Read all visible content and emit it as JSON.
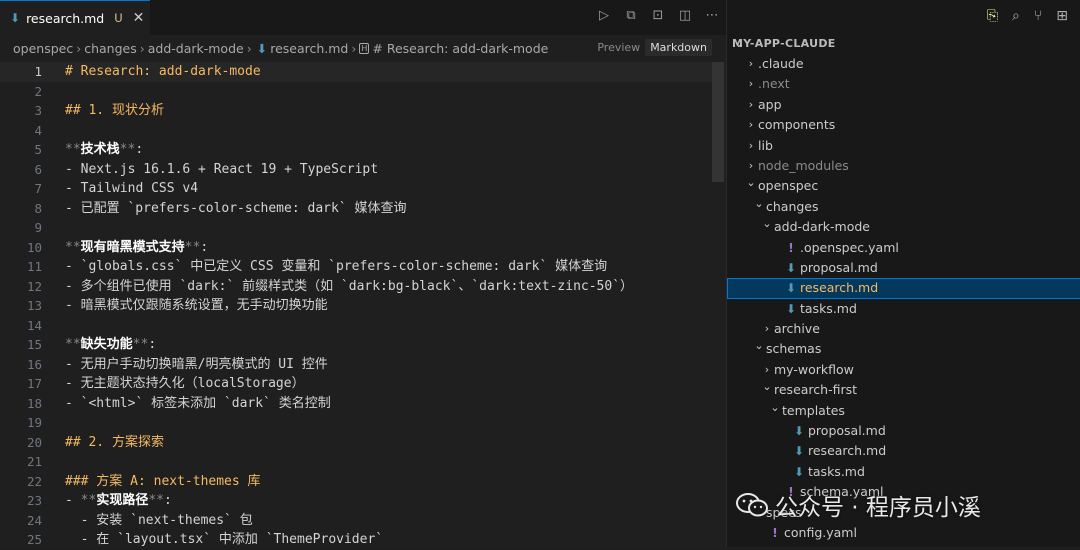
{
  "tab": {
    "title": "research.md",
    "modified": "U",
    "close": "✕"
  },
  "breadcrumb": {
    "parts": [
      "openspec",
      "changes",
      "add-dark-mode",
      "research.md",
      "# Research: add-dark-mode"
    ],
    "preview_label": "Preview",
    "markdown_label": "Markdown"
  },
  "editor": {
    "lines": [
      {
        "n": "1",
        "text": "# Research: add-dark-mode",
        "cls": "h1",
        "current": true
      },
      {
        "n": "2",
        "text": ""
      },
      {
        "n": "3",
        "text": "## 1. 现状分析",
        "cls": "h2"
      },
      {
        "n": "4",
        "text": ""
      },
      {
        "n": "5",
        "bold": "技术栈",
        "tail": ":"
      },
      {
        "n": "6",
        "text": "- Next.js 16.1.6 + React 19 + TypeScript"
      },
      {
        "n": "7",
        "text": "- Tailwind CSS v4"
      },
      {
        "n": "8",
        "text": "- 已配置 `prefers-color-scheme: dark` 媒体查询"
      },
      {
        "n": "9",
        "text": ""
      },
      {
        "n": "10",
        "bold": "现有暗黑模式支持",
        "tail": ":"
      },
      {
        "n": "11",
        "text": "- `globals.css` 中已定义 CSS 变量和 `prefers-color-scheme: dark` 媒体查询"
      },
      {
        "n": "12",
        "text": "- 多个组件已使用 `dark:` 前缀样式类（如 `dark:bg-black`、`dark:text-zinc-50`）"
      },
      {
        "n": "13",
        "text": "- 暗黑模式仅跟随系统设置，无手动切换功能"
      },
      {
        "n": "14",
        "text": ""
      },
      {
        "n": "15",
        "bold": "缺失功能",
        "tail": ":"
      },
      {
        "n": "16",
        "text": "- 无用户手动切换暗黑/明亮模式的 UI 控件"
      },
      {
        "n": "17",
        "text": "- 无主题状态持久化（localStorage）"
      },
      {
        "n": "18",
        "text": "- `<html>` 标签未添加 `dark` 类名控制"
      },
      {
        "n": "19",
        "text": ""
      },
      {
        "n": "20",
        "text": "## 2. 方案探索",
        "cls": "h2"
      },
      {
        "n": "21",
        "text": ""
      },
      {
        "n": "22",
        "text": "### 方案 A: next-themes 库",
        "cls": "h3"
      },
      {
        "n": "23",
        "prefix": "- ",
        "bold": "实现路径",
        "tail": ":"
      },
      {
        "n": "24",
        "text": "  - 安装 `next-themes` 包"
      },
      {
        "n": "25",
        "text": "  - 在 `layout.tsx` 中添加 `ThemeProvider`"
      }
    ]
  },
  "explorer": {
    "title": "MY-APP-CLAUDE",
    "collapse_glyph": "⌄",
    "items": [
      {
        "label": ".claude",
        "depth": 0,
        "type": "folder",
        "open": false
      },
      {
        "label": ".next",
        "depth": 0,
        "type": "folder",
        "open": false,
        "dim": true
      },
      {
        "label": "app",
        "depth": 0,
        "type": "folder",
        "open": false
      },
      {
        "label": "components",
        "depth": 0,
        "type": "folder",
        "open": false
      },
      {
        "label": "lib",
        "depth": 0,
        "type": "folder",
        "open": false
      },
      {
        "label": "node_modules",
        "depth": 0,
        "type": "folder",
        "open": false,
        "dim": true
      },
      {
        "label": "openspec",
        "depth": 0,
        "type": "folder",
        "open": true
      },
      {
        "label": "changes",
        "depth": 1,
        "type": "folder",
        "open": true
      },
      {
        "label": "add-dark-mode",
        "depth": 2,
        "type": "folder",
        "open": true
      },
      {
        "label": ".openspec.yaml",
        "depth": 3,
        "type": "yaml"
      },
      {
        "label": "proposal.md",
        "depth": 3,
        "type": "md"
      },
      {
        "label": "research.md",
        "depth": 3,
        "type": "md",
        "selected": true
      },
      {
        "label": "tasks.md",
        "depth": 3,
        "type": "md"
      },
      {
        "label": "archive",
        "depth": 2,
        "type": "folder",
        "open": false
      },
      {
        "label": "schemas",
        "depth": 1,
        "type": "folder",
        "open": true
      },
      {
        "label": "my-workflow",
        "depth": 2,
        "type": "folder",
        "open": false
      },
      {
        "label": "research-first",
        "depth": 2,
        "type": "folder",
        "open": true
      },
      {
        "label": "templates",
        "depth": 3,
        "type": "folder",
        "open": true
      },
      {
        "label": "proposal.md",
        "depth": 4,
        "type": "md"
      },
      {
        "label": "research.md",
        "depth": 4,
        "type": "md"
      },
      {
        "label": "tasks.md",
        "depth": 4,
        "type": "md"
      },
      {
        "label": "schema.yaml",
        "depth": 3,
        "type": "yaml"
      },
      {
        "label": "specs",
        "depth": 1,
        "type": "folder",
        "open": false
      },
      {
        "label": "config.yaml",
        "depth": 1,
        "type": "yaml"
      }
    ]
  },
  "watermark": {
    "text": "公众号 · 程序员小溪"
  }
}
